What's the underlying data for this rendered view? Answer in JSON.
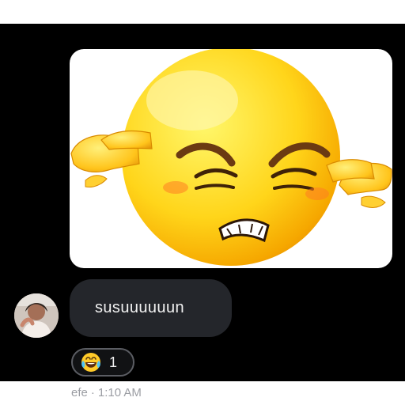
{
  "conversation": {
    "image_card": {
      "icon": "annoyed-emoji-covering-ears"
    },
    "message": {
      "text": "susuuuuuun",
      "avatar_icon": "user-avatar"
    },
    "reaction": {
      "emoji": "face-with-tears-of-joy",
      "count": "1"
    },
    "meta": {
      "sender": "efe",
      "separator": "·",
      "time": "1:10 AM"
    }
  },
  "colors": {
    "background": "#000000",
    "bubble": "#24262b",
    "meta_text": "#9b9da3",
    "reaction_border": "#5b5d63"
  }
}
